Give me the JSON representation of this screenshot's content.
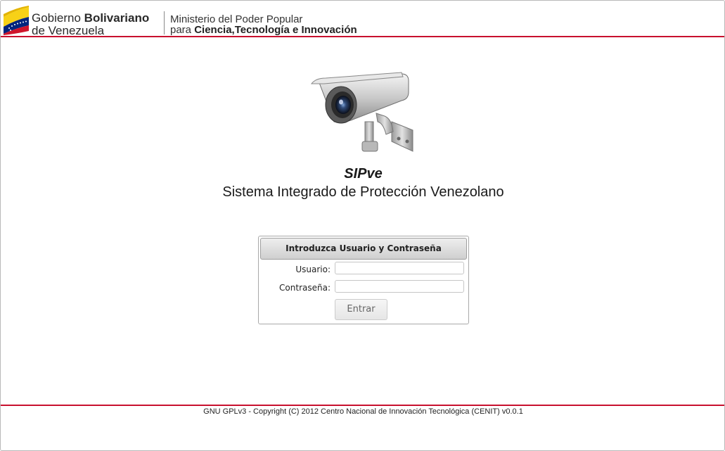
{
  "header": {
    "gov_prefix": "Gobierno ",
    "gov_bold": "Bolivariano",
    "gov_line2": "de Venezuela",
    "ministry_line1": "Ministerio del Poder Popular",
    "ministry_prefix": "para ",
    "ministry_bold": "Ciencia,Tecnología e Innovación",
    "logo_icon": "venezuela-flag-icon"
  },
  "hero": {
    "icon": "security-camera-icon",
    "app_name": "SIPve",
    "app_description": "Sistema Integrado de Protección Venezolano"
  },
  "login": {
    "header": "Introduzca Usuario y Contraseña",
    "user_label": "Usuario:",
    "user_value": "",
    "password_label": "Contraseña:",
    "password_value": "",
    "submit_label": "Entrar"
  },
  "footer": {
    "text": "GNU GPLv3 - Copyright (C) 2012 Centro Nacional de Innovación Tecnológica (CENIT) v0.0.1"
  },
  "colors": {
    "accent_red": "#c8102e",
    "flag_yellow": "#f7d117",
    "flag_blue": "#00247d",
    "flag_red": "#cf142b"
  }
}
